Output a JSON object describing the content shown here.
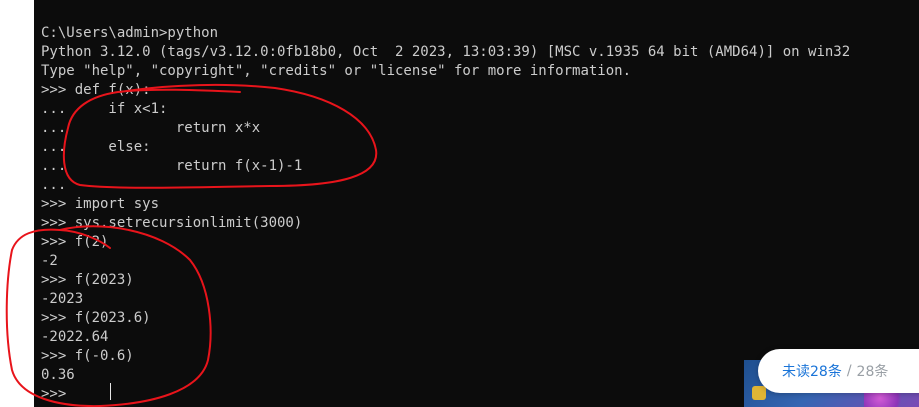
{
  "terminal": {
    "lines": [
      "C:\\Users\\admin>python",
      "Python 3.12.0 (tags/v3.12.0:0fb18b0, Oct  2 2023, 13:03:39) [MSC v.1935 64 bit (AMD64)] on win32",
      "Type \"help\", \"copyright\", \"credits\" or \"license\" for more information.",
      ">>> def f(x):",
      "...     if x<1:",
      "...             return x*x",
      "...     else:",
      "...             return f(x-1)-1",
      "...",
      ">>> import sys",
      ">>> sys.setrecursionlimit(3000)",
      ">>> f(2)",
      "-2",
      ">>> f(2023)",
      "-2023",
      ">>> f(2023.6)",
      "-2022.64",
      ">>> f(-0.6)",
      "0.36",
      ">>> "
    ]
  },
  "unread_widget": {
    "unread": "未读28条",
    "separator": "/",
    "total": "28条"
  },
  "colors": {
    "terminal_bg": "#0c0c0c",
    "terminal_text": "#cccccc",
    "annotation_red": "#e8141b",
    "unread_blue": "#1a74d8",
    "total_gray": "#9aa0a6"
  }
}
